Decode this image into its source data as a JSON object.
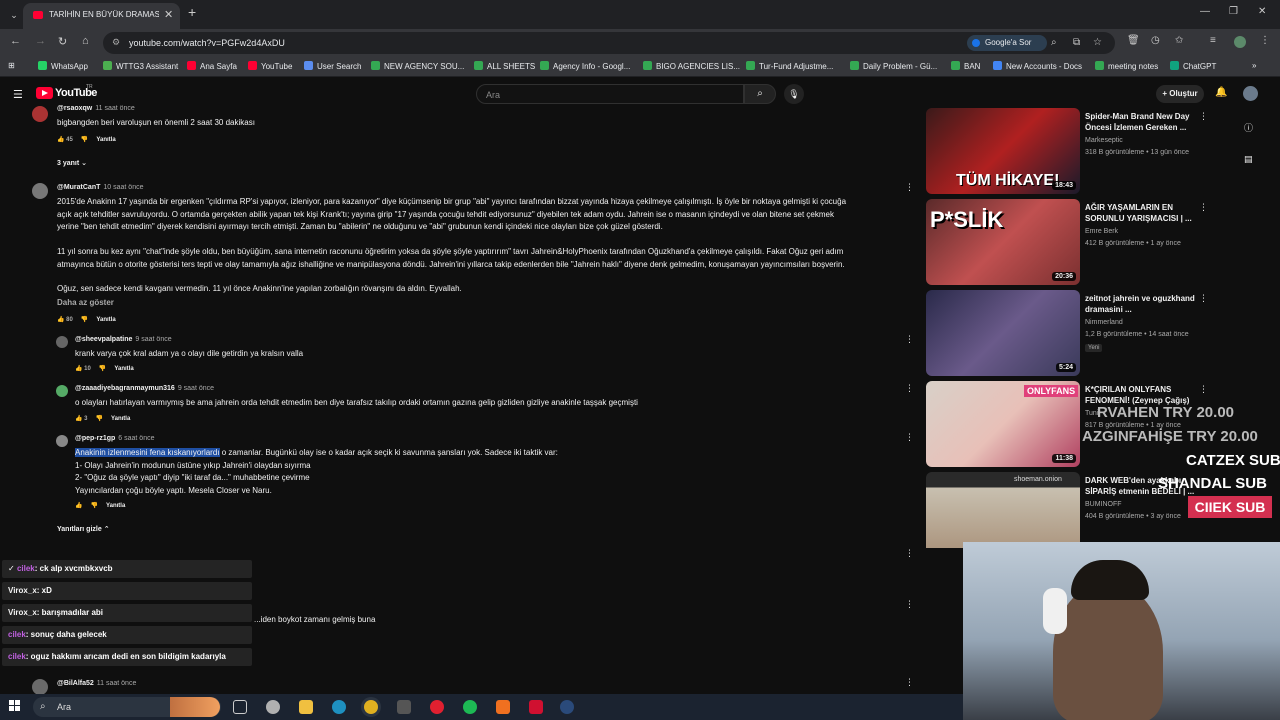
{
  "browser": {
    "tab_title": "TARİHİN EN BÜYÜK DRAMASI |",
    "url": "youtube.com/watch?v=PGFw2d4AxDU",
    "google_ask": "Google'a Sor",
    "bookmarks": [
      "WhatsApp",
      "WTTG3 Assistant",
      "Ana Sayfa",
      "YouTube",
      "User Search",
      "NEW AGENCY SOU...",
      "ALL SHEETS",
      "Agency Info - Googl...",
      "BIGO AGENCIES LIS...",
      "Tur-Fund Adjustme...",
      "Daily Problem - Gü...",
      "BAN",
      "New Accounts - Docs",
      "meeting notes",
      "ChatGPT"
    ]
  },
  "youtube": {
    "logo_text": "YouTube",
    "region": "TR",
    "search_placeholder": "Ara",
    "create_label": "Oluştur"
  },
  "comments": [
    {
      "author": "@rsaoxqw",
      "time": "11 saat önce",
      "lines": [
        "bigbangden beri varoluşun en önemli 2 saat 30 dakikası"
      ],
      "likes": "45",
      "reply": "Yanıtla"
    },
    {
      "replies_toggle": "3 yanıt"
    },
    {
      "author": "@MuratCanT",
      "time": "10 saat önce",
      "lines": [
        "2015'de Anakinn 17 yaşında bir ergenken \"çıldırma RP'si yapıyor, izleniyor, para kazanıyor\" diye küçümsenip bir grup \"abi\" yayıncı tarafından bizzat yayında hizaya çekilmeye çalışılmıştı. İş öyle bir noktaya gelmişti ki çocuğa",
        "açık açık tehditler savruluyordu. O ortamda gerçekten abilik yapan tek kişi Krank'tı; yayına girip \"17 yaşında çocuğu tehdit ediyorsunuz\" diyebilen tek adam oydu. Jahrein ise o masanın içindeydi ve olan bitene set çekmek",
        "yerine \"ben tehdit etmedim\" diyerek kendisini ayırmayı tercih etmişti. Zaman bu \"abilerin\" ne olduğunu ve \"abi\" grubunun kendi içindeki nice olayları bize çok güzel gösterdi.",
        "",
        "11 yıl sonra bu kez aynı \"chat\"inde şöyle oldu, ben büyüğüm, sana internetin raconunu öğretirim yoksa da şöyle şöyle yaptırırım\" tavrı Jahrein&HolyPhoenix tarafından Oğuzkhand'a çekilmeye çalışıldı. Fakat Oğuz geri adım",
        "atmayınca bütün o otorite gösterisi ters tepti ve olay tamamıyla ağız ishalliğine ve manipülasyona döndü. Jahrein'ini yıllarca takip edenlerden bile \"Jahrein haklı\" diyene denk gelmedim, konuşamayan yayıncımsıları boşverin.",
        "",
        "Oğuz, sen sadece kendi kavganı vermedin. 11 yıl önce Anakinn'ine yapılan zorbalığın rövanşını da aldın. Eyvallah."
      ],
      "show_less": "Daha az göster",
      "likes": "80",
      "reply": "Yanıtla"
    },
    {
      "author": "@sheevpalpatine",
      "time": "9 saat önce",
      "lines": [
        "krank varya çok kral adam ya o olayı dile getirdin ya kralsın valla"
      ],
      "likes": "10",
      "reply": "Yanıtla"
    },
    {
      "author": "@zaaadiyebagranmaymun316",
      "time": "9 saat önce",
      "lines": [
        "o olayları hatırlayan varmıymış be ama jahrein orda tehdit etmedim ben diye tarafsız takılıp ordaki ortamın gazına gelip gizliden gizliye anakinle taşşak geçmişti"
      ],
      "likes": "3",
      "reply": "Yanıtla"
    },
    {
      "author": "@pep-rz1gp",
      "time": "6 saat önce",
      "highlighted": "Anakinin izlenmesini fena kıskanıyorlardı",
      "lines": [
        " o zamanlar. Bugünkü olay ise o kadar açık seçik ki savunma şansları yok. Sadece iki taktik var:",
        "1- Olayı Jahrein'in modunun üstüne yıkıp Jahrein'i olaydan sıyırma",
        "2- \"Oğuz da şöyle yaptı\" diyip \"iki taraf da...\" muhabbetine çevirme",
        "Yayıncılardan çoğu böyle yaptı. Mesela Closer ve Naru."
      ],
      "reply": "Yanıtla"
    },
    {
      "hide_replies": "Yanıtları gizle"
    },
    {
      "partial_text": "...iden boykot zamanı gelmiş buna"
    },
    {
      "author": "@BilAlfa52",
      "time": "11 saat önce"
    }
  ],
  "chat": [
    {
      "user": "cilek",
      "msg": ": ck alp xvcmbkxvcb",
      "pink": true
    },
    {
      "user": "Virox_x",
      "msg": ": xD",
      "pink": false
    },
    {
      "user": "Virox_x",
      "msg": ": barışmadılar abi",
      "pink": false
    },
    {
      "user": "cilek",
      "msg": ": sonuç daha gelecek",
      "pink": true
    },
    {
      "user": "cilek",
      "msg": ": oguz hakkımı arıcam dedi en son bildigim kadarıyla",
      "pink": true
    }
  ],
  "recommendations": [
    {
      "title": "Spider-Man Brand New Day Öncesi İzlemen Gereken ...",
      "channel": "Markeseptic",
      "meta": "318 B görüntüleme • 13 gün önce",
      "duration": "18:43",
      "thumb_text": "TÜM HİKAYE!"
    },
    {
      "title": "AĞIR YAŞAMLARIN EN SORUNLU YARIŞMACISI | ...",
      "channel": "Emre Berk",
      "meta": "412 B görüntüleme • 1 ay önce",
      "duration": "20:36",
      "thumb_text": "P*SLİK"
    },
    {
      "title": "zeitnot jahrein ve oguzkhand dramasini ...",
      "channel": "Nimmerland",
      "meta": "1,2 B görüntüleme • 14 saat önce",
      "duration": "5:24",
      "badge": "Yeni"
    },
    {
      "title": "K*ÇIRILAN ONLYFANS FENOMENİ! (Zeynep Çağış)",
      "channel": "Tuni",
      "meta": "817 B görüntüleme • 1 ay önce",
      "duration": "11:38",
      "thumb_text": "ONLYFANS"
    },
    {
      "title": "DARK WEB'den ayakkabı SİPARİŞ etmenin BEDELİ | ...",
      "channel": "BUMINOFF",
      "meta": "404 B görüntüleme • 3 ay önce",
      "thumb_text": "shoeman.onion"
    }
  ],
  "overlay": {
    "lines": [
      "RVAHEN TRY 20.00",
      "AZGINFAHİŞE TRY 20.00",
      "CATZEX SUB",
      "SHANDAL SUB"
    ],
    "badge": "CIIEK SUB"
  },
  "taskbar": {
    "search_label": "Ara"
  }
}
